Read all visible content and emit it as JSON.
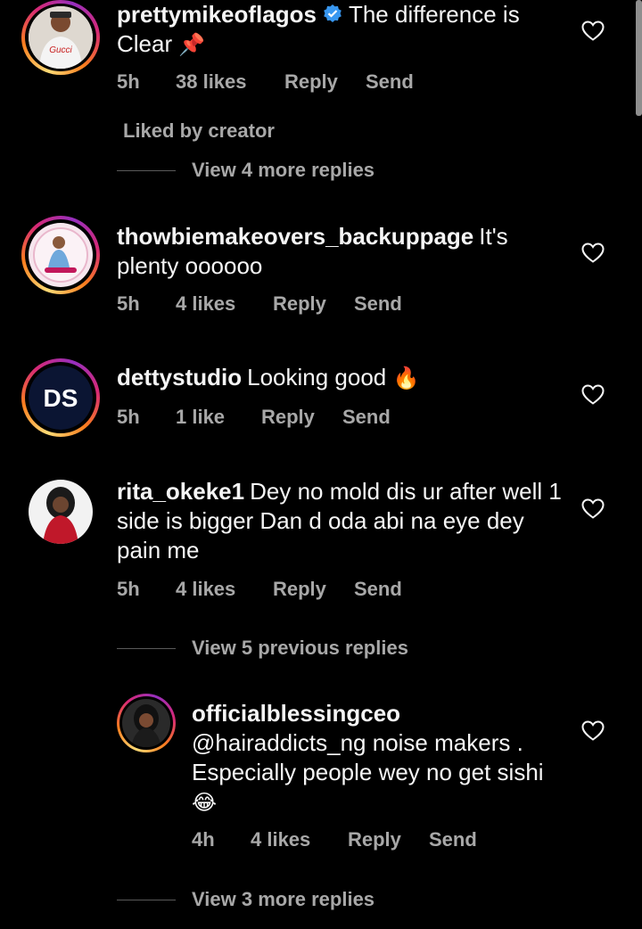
{
  "comments": [
    {
      "username": "prettymikeoflagos",
      "verified": true,
      "text": "The difference is Clear",
      "emoji": "📌",
      "time": "5h",
      "likes": "38 likes",
      "reply": "Reply",
      "send": "Send"
    },
    {
      "username": "thowbiemakeovers_backuppage",
      "text": "It's plenty oooooo",
      "time": "5h",
      "likes": "4 likes",
      "reply": "Reply",
      "send": "Send"
    },
    {
      "username": "dettystudio",
      "text": "Looking good",
      "emoji": "🔥",
      "time": "5h",
      "likes": "1 like",
      "reply": "Reply",
      "send": "Send"
    },
    {
      "username": "rita_okeke1",
      "text": "Dey no mold dis ur after well 1 side is bigger Dan d oda abi na eye dey pain me",
      "time": "5h",
      "likes": "4 likes",
      "reply": "Reply",
      "send": "Send"
    },
    {
      "username": "officialblessingceo",
      "text": "@hairaddicts_ng noise makers . Especially people wey no get sishi",
      "emoji": "😂",
      "time": "4h",
      "likes": "4 likes",
      "reply": "Reply",
      "send": "Send"
    }
  ],
  "liked_by_creator": "Liked by creator",
  "view_more_1": "View 4 more replies",
  "view_previous": "View 5 previous replies",
  "view_more_2": "View 3 more replies",
  "avatar_text": {
    "shirt_brand": "Gucci",
    "studio_logo": "DS"
  },
  "colors": {
    "background": "#000000",
    "text": "#f5f5f5",
    "meta": "#a8a8a8",
    "verified": "#3897f0"
  },
  "icons": [
    "heart-icon",
    "verified-badge-icon",
    "pin-emoji",
    "fire-emoji",
    "laughing-emoji"
  ]
}
